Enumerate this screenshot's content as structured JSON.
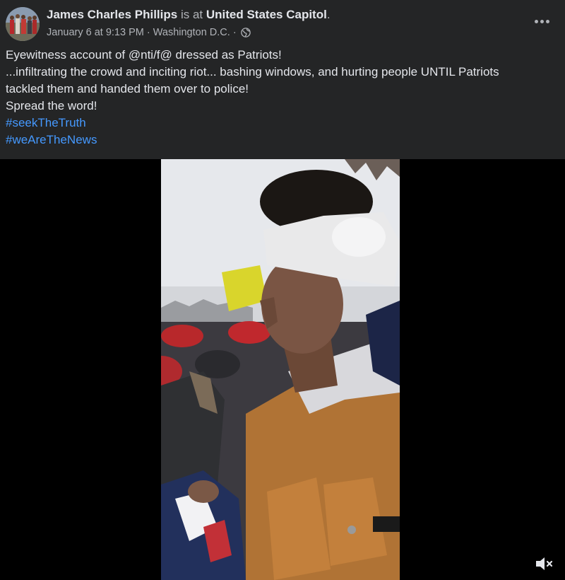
{
  "post": {
    "author": "James Charles Phillips",
    "is_at": "is at",
    "location": "United States Capitol",
    "period": ".",
    "date": "January 6 at 9:13 PM",
    "sep1": "·",
    "city": "Washington D.C.",
    "sep2": "·",
    "audience_icon": "globe-icon",
    "text_lines": [
      "Eyewitness account of @nti/f@ dressed as Patriots!",
      "...infiltrating the crowd and inciting riot... bashing windows, and hurting people UNTIL Patriots",
      "tackled them and handed them over to police!",
      "Spread the word!"
    ],
    "hashtags": [
      "#seekTheTruth",
      "#weAreTheNews"
    ]
  },
  "video": {
    "mute_icon": "volume-muted-icon"
  },
  "colors": {
    "background": "#242526",
    "text": "#e4e6eb",
    "muted": "#b0b3b8",
    "link": "#4599ff"
  }
}
